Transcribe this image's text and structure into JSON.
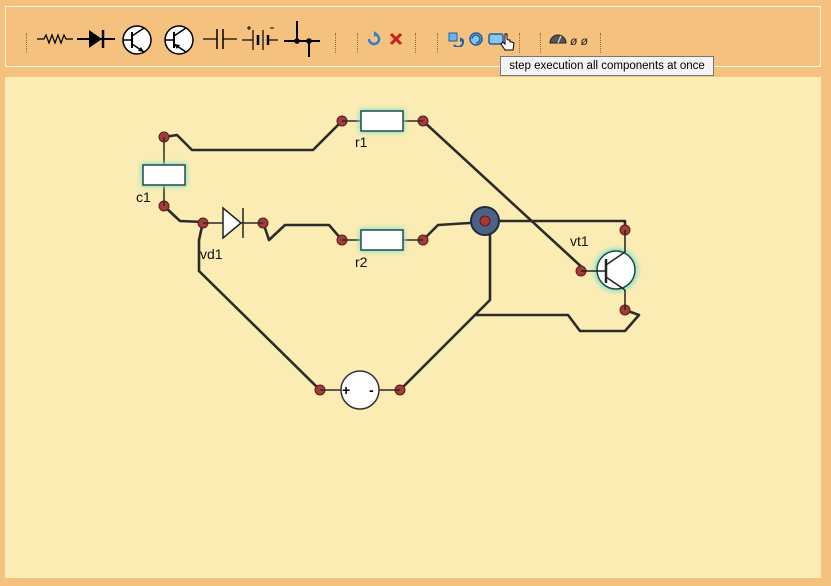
{
  "toolbar": {
    "groups": [
      {
        "name": "components",
        "items": [
          "resistor-icon",
          "diode-icon",
          "npn-transistor-icon",
          "pnp-transistor-icon",
          "capacitor-icon",
          "battery-icon",
          "junction-icon"
        ]
      },
      {
        "name": "edit",
        "items": [
          "rotate-icon",
          "delete-icon"
        ]
      },
      {
        "name": "simulation",
        "items": [
          "step-icon",
          "step-component-icon",
          "step-all-icon"
        ]
      },
      {
        "name": "display",
        "items": [
          "meter-icon"
        ]
      }
    ],
    "meter_readout": "ø ø"
  },
  "tooltip": {
    "text": "step execution all components at once"
  },
  "components": {
    "r1": {
      "label": "r1"
    },
    "r2": {
      "label": "r2"
    },
    "c1": {
      "label": "c1"
    },
    "vd1": {
      "label": "vd1"
    },
    "vt1": {
      "label": "vt1"
    },
    "source": {
      "plus": "+",
      "minus": "-"
    }
  },
  "colors": {
    "toolbar": "#f4c27e",
    "canvas": "#fbecb4",
    "wire": "#2b2b2b",
    "terminal": "#a33b3b",
    "glow": "#8fe3c9",
    "node": "#4d6282"
  }
}
